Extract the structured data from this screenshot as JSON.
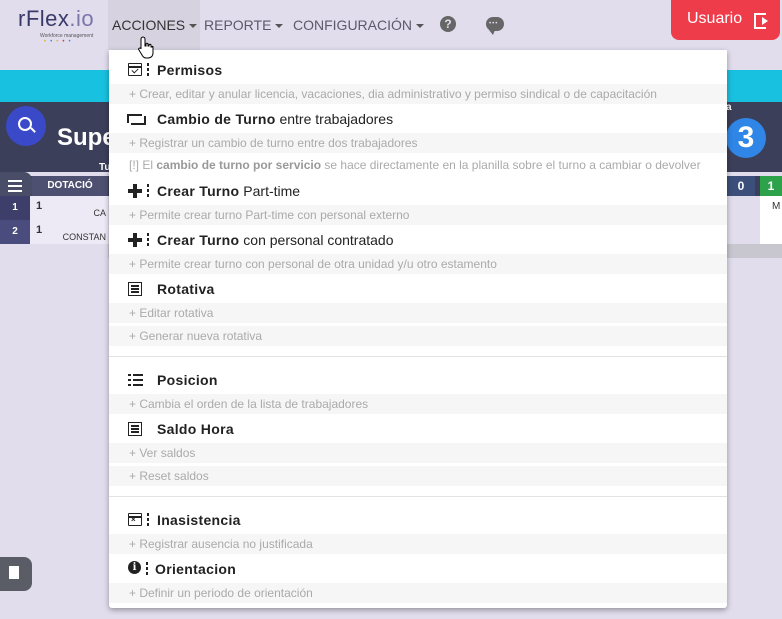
{
  "brand": {
    "name_main": "rFlex",
    "name_suffix": ".io",
    "tagline": "Workforce management"
  },
  "nav": {
    "acciones": "ACCIONES",
    "reporte": "REPORTE",
    "configuracion": "CONFIGURACIÓN",
    "help_glyph": "?"
  },
  "user_button": {
    "label": "Usuario"
  },
  "background": {
    "title": "Supe",
    "turno_label": "Tu",
    "dotacion_header": "DOTACIÓ",
    "right_label": "a",
    "right_circle": "3",
    "rows": [
      {
        "num": "1",
        "count": "1",
        "text": "CA"
      },
      {
        "num": "2",
        "count": "1",
        "text": "CONSTAN"
      }
    ],
    "tile_zero": "0",
    "tile_one": "1",
    "tile_m": "M"
  },
  "menu": {
    "permisos": {
      "title": "Permisos",
      "desc": "+ Crear, editar y anular licencia, vacaciones, dia administrativo y permiso sindical o de capacitación"
    },
    "cambio_turno": {
      "title_bold": "Cambio de Turno",
      "title_rest": " entre trabajadores",
      "desc": "+ Registrar un cambio de turno entre dos trabajadores",
      "note_prefix": "[!] El ",
      "note_bold": "cambio de turno por servicio",
      "note_rest": " se hace directamente en la planilla sobre el turno a cambiar o devolver"
    },
    "crear_part_time": {
      "title_bold": "Crear Turno",
      "title_rest": " Part-time",
      "desc": "+ Permite crear turno Part-time con personal externo"
    },
    "crear_contratado": {
      "title_bold": "Crear Turno",
      "title_rest": " con personal contratado",
      "desc": "+ Permite crear turno con personal de otra unidad y/u otro estamento"
    },
    "rotativa": {
      "title": "Rotativa",
      "desc1": "+ Editar rotativa",
      "desc2": "+ Generar nueva rotativa"
    },
    "posicion": {
      "title": "Posicion",
      "desc": "+ Cambia el orden de la lista de trabajadores"
    },
    "saldo_hora": {
      "title": "Saldo Hora",
      "desc1": "+ Ver saldos",
      "desc2": "+ Reset saldos"
    },
    "inasistencia": {
      "title": "Inasistencia",
      "desc": "+ Registrar ausencia no justificada"
    },
    "orientacion": {
      "title": "Orientacion",
      "desc": "+ Definir un periodo de orientación"
    }
  },
  "icons": {
    "permisos": "calendar-check-icon",
    "cambio": "swap-icon",
    "crear": "plus-icon",
    "rotativa": "list-icon",
    "posicion": "ordered-list-icon",
    "saldo": "list-icon",
    "inasistencia": "calendar-x-icon",
    "orientacion": "info-icon"
  },
  "colors": {
    "accent_red": "#ee3c4a",
    "cyan": "#19c1e0",
    "nav_bg": "#e1dded"
  }
}
